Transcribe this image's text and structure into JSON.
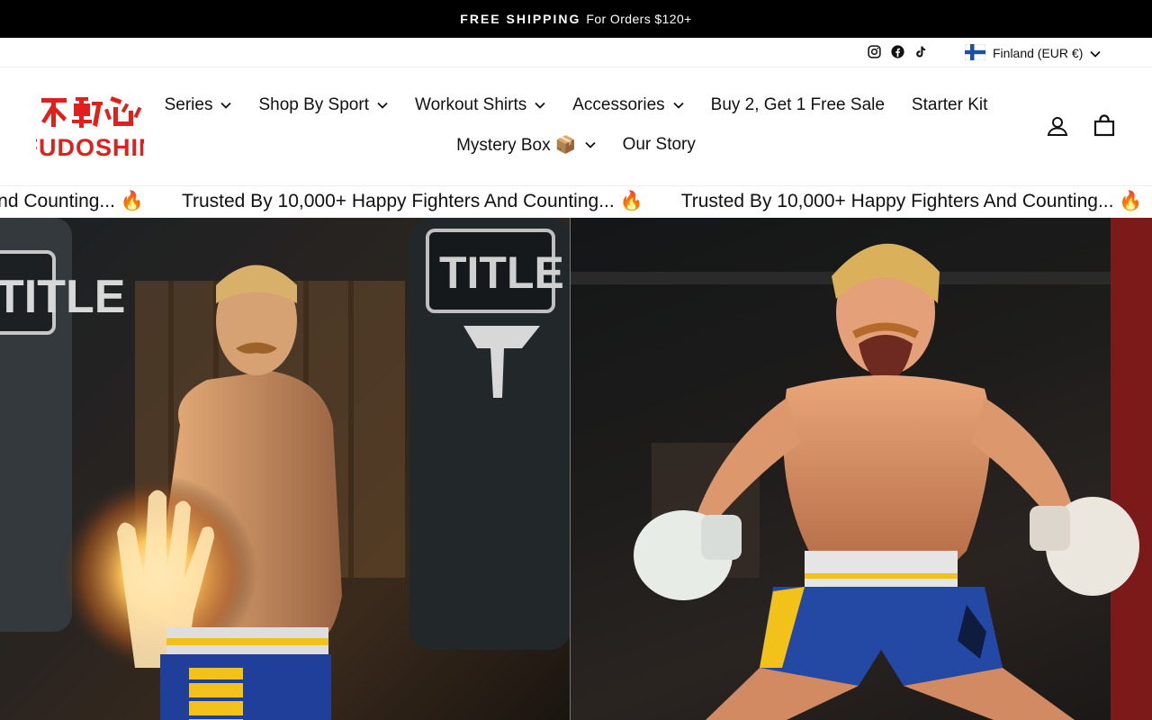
{
  "announcement": {
    "strong": "FREE SHIPPING",
    "text": "For Orders $120+"
  },
  "utility": {
    "social": [
      "instagram-icon",
      "facebook-icon",
      "tiktok-icon"
    ],
    "country_label": "Finland (EUR €)"
  },
  "brand": {
    "name": "FUDOSHIN",
    "kanji": "不動心",
    "color": "#e0201b"
  },
  "nav": {
    "row1": [
      {
        "label": "Series",
        "dropdown": true
      },
      {
        "label": "Shop By Sport",
        "dropdown": true
      },
      {
        "label": "Workout Shirts",
        "dropdown": true
      },
      {
        "label": "Accessories",
        "dropdown": true
      },
      {
        "label": "Buy 2, Get 1 Free Sale",
        "dropdown": false
      },
      {
        "label": "Starter Kit",
        "dropdown": false
      }
    ],
    "row2": [
      {
        "label": "Mystery Box 📦",
        "dropdown": true
      },
      {
        "label": "Our Story",
        "dropdown": false
      }
    ]
  },
  "header_icons": [
    "account-icon",
    "cart-icon"
  ],
  "ticker": {
    "message": "Trusted By 10,000+ Happy Fighters And Counting... 🔥",
    "partial_left": "s And Counting... 🔥"
  },
  "hero": {
    "bag_brand": "TITLE"
  }
}
